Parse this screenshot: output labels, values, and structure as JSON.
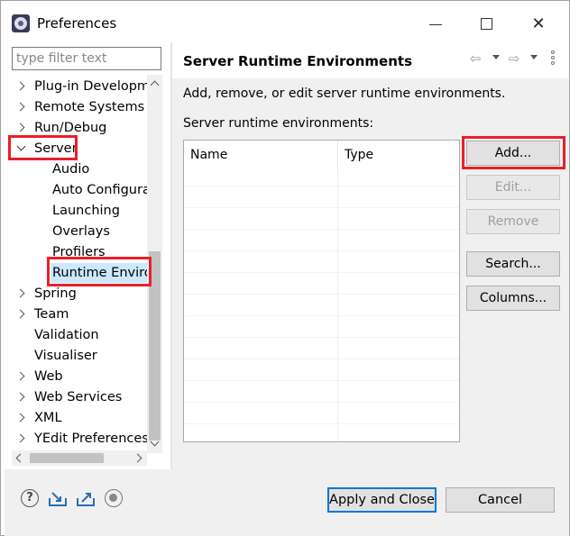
{
  "window": {
    "title": "Preferences"
  },
  "filter": {
    "placeholder": "type filter text"
  },
  "tree": {
    "items": [
      {
        "label": "Plug-in Developm",
        "twisty": "right",
        "indent": 0
      },
      {
        "label": "Remote Systems",
        "twisty": "right",
        "indent": 0
      },
      {
        "label": "Run/Debug",
        "twisty": "right",
        "indent": 0
      },
      {
        "label": "Server",
        "twisty": "down",
        "indent": 0
      },
      {
        "label": "Audio",
        "twisty": "none",
        "indent": 1
      },
      {
        "label": "Auto Configura",
        "twisty": "none",
        "indent": 1
      },
      {
        "label": "Launching",
        "twisty": "none",
        "indent": 1
      },
      {
        "label": "Overlays",
        "twisty": "none",
        "indent": 1
      },
      {
        "label": "Profilers",
        "twisty": "none",
        "indent": 1
      },
      {
        "label": "Runtime Enviro",
        "twisty": "none",
        "indent": 1,
        "selected": true
      },
      {
        "label": "Spring",
        "twisty": "right",
        "indent": 0
      },
      {
        "label": "Team",
        "twisty": "right",
        "indent": 0
      },
      {
        "label": "Validation",
        "twisty": "none",
        "indent": 0
      },
      {
        "label": "Visualiser",
        "twisty": "none",
        "indent": 0
      },
      {
        "label": "Web",
        "twisty": "right",
        "indent": 0
      },
      {
        "label": "Web Services",
        "twisty": "right",
        "indent": 0
      },
      {
        "label": "XML",
        "twisty": "right",
        "indent": 0
      },
      {
        "label": "YEdit Preferences",
        "twisty": "right",
        "indent": 0
      }
    ]
  },
  "page": {
    "title": "Server Runtime Environments",
    "description": "Add, remove, or edit server runtime environments.",
    "list_label": "Server runtime environments:",
    "columns": {
      "name": "Name",
      "type": "Type"
    }
  },
  "buttons": {
    "add": "Add...",
    "edit": "Edit...",
    "remove": "Remove",
    "search": "Search...",
    "columns": "Columns..."
  },
  "dialog": {
    "apply_close": "Apply and Close",
    "cancel": "Cancel"
  },
  "icons": {
    "help": "?"
  },
  "colors": {
    "highlight": "#e8202a",
    "selection": "#cce8ff",
    "default_button_border": "#0078d7"
  }
}
